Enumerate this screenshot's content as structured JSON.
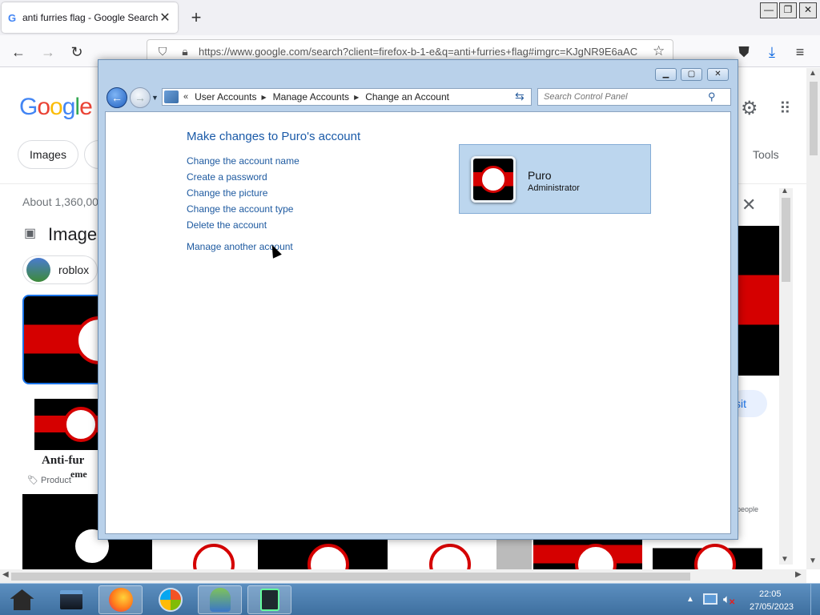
{
  "browser": {
    "tab_title": "anti furries flag - Google Search",
    "tab_favicon": "G",
    "new_tab": "+",
    "url": "https://www.google.com/search?client=firefox-b-1-e&q=anti+furries+flag#imgrc=KJgNR9E6aAC"
  },
  "google": {
    "logo": {
      "g1": "G",
      "o1": "o",
      "o2": "o",
      "g2": "g",
      "l": "l",
      "e": "e"
    },
    "chip_images": "Images",
    "tools": "Tools",
    "about": "About 1,360,00",
    "images_heading": "Image",
    "chip_roblox": "roblox",
    "thumb_text_1": "Anti-fur",
    "thumb_text_2": "eme",
    "product_label": "Product",
    "visit": "sit",
    "people_label": "people"
  },
  "control_panel": {
    "breadcrumbs": [
      "User Accounts",
      "Manage Accounts",
      "Change an Account"
    ],
    "search_placeholder": "Search Control Panel",
    "heading": "Make changes to Puro's account",
    "tasks": {
      "change_name": "Change the account name",
      "create_password": "Create a password",
      "change_picture": "Change the picture",
      "change_type": "Change the account type",
      "delete_account": "Delete the account",
      "manage_another": "Manage another account"
    },
    "account": {
      "name": "Puro",
      "role": "Administrator"
    }
  },
  "taskbar": {
    "time": "22:05",
    "date": "27/05/2023"
  },
  "colors": {
    "google_blue": "#4285f4",
    "google_red": "#ea4335",
    "google_yellow": "#fbbc05",
    "google_green": "#34a853",
    "cp_link": "#1e5aa0",
    "flag_red": "#d50000"
  },
  "icons": [
    "back-arrow-icon",
    "forward-arrow-icon",
    "reload-icon",
    "shield-icon",
    "lock-icon",
    "star-icon",
    "pocket-icon",
    "download-icon",
    "hamburger-menu-icon",
    "gear-icon",
    "apps-grid-icon",
    "close-icon",
    "magnifier-icon",
    "refresh-icon",
    "home-icon",
    "firefox-icon",
    "windows-orb-icon",
    "network-icon",
    "volume-muted-icon"
  ]
}
